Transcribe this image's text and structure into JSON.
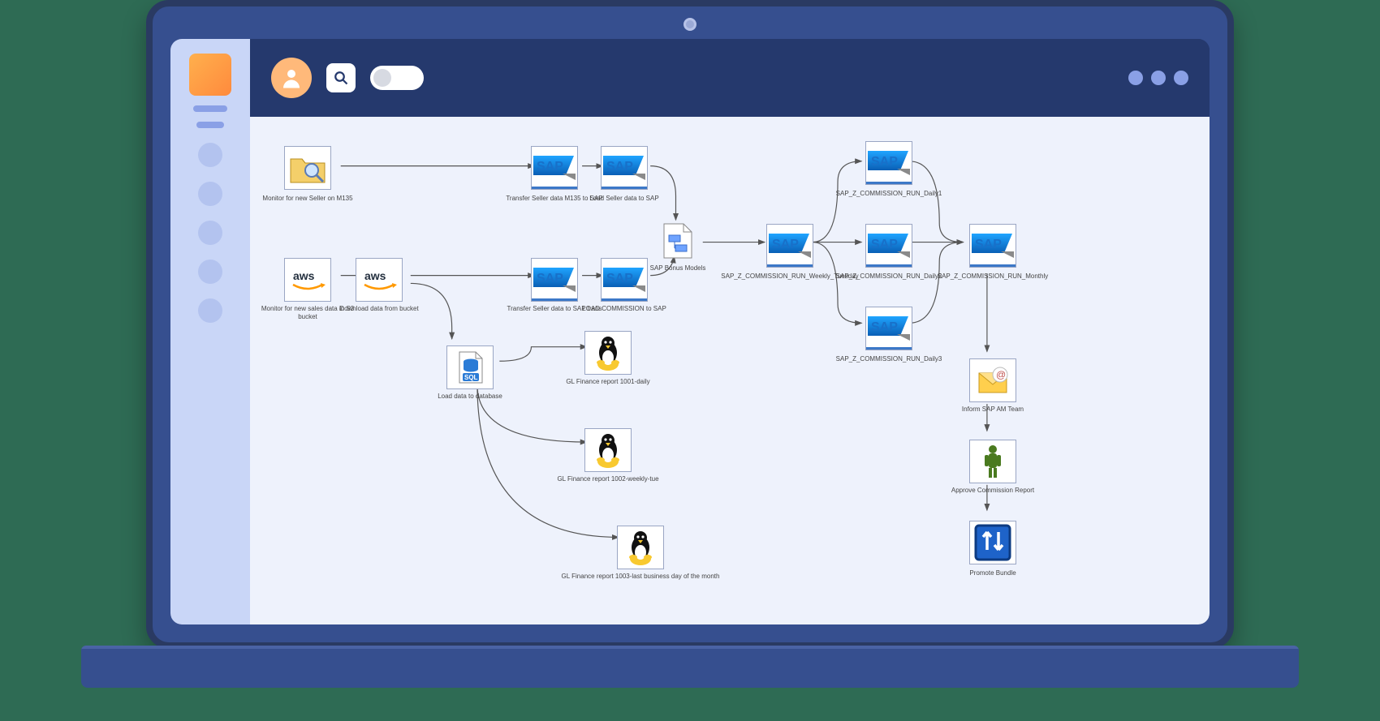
{
  "nodes": {
    "monitor_m135": "Monitor for new Seller on M135",
    "monitor_s3": "Monitor for new sales data in S3 bucket",
    "download_bucket": "Download data from bucket",
    "load_db": "Load data to database",
    "transfer_m135": "Transfer Seller data M135 to SAP",
    "load_seller": "Load Seller data  to SAP",
    "transfer_trans": "Transfer Seller data to SAP trans",
    "load_commission": "LOAD COMMISSION to SAP",
    "sap_bonus": "SAP Bonus Models",
    "gl_1001": "GL Finance report 1001-daily",
    "gl_1002": "GL Finance report 1002-weekly-tue",
    "gl_1003": "GL Finance report 1003-last business day of the month",
    "weekly_tue": "SAP_Z_COMMISSION_RUN_Weekly_Tuesday",
    "daily1": "SAP_Z_COMMISSION_RUN_Daily1",
    "daily2": "SAP_Z_COMMISSION_RUN_Daily2",
    "daily3": "SAP_Z_COMMISSION_RUN_Daily3",
    "monthly": "SAP_Z_COMMISSION_RUN_Monthly",
    "inform": "Inform SAP AM Team",
    "approve": "Approve Commission Report",
    "promote": "Promote Bundle"
  }
}
